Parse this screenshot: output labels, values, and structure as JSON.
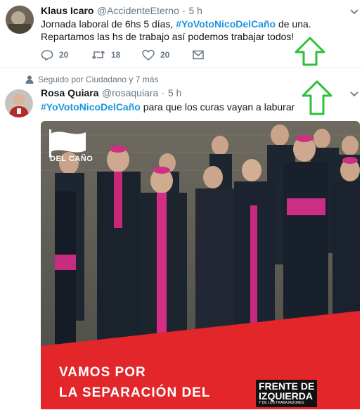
{
  "tweet1": {
    "name": "Klaus Icaro",
    "handle": "@AccidenteEterno",
    "sep": "·",
    "time": "5 h",
    "text_before": "Jornada laboral de 6hs 5 días, ",
    "hashtag": "#YoVotoNicoDelCaño",
    "text_after": " de una. Repartamos las hs de trabajo así podemos trabajar todos!",
    "replies": "20",
    "retweets": "18",
    "likes": "20"
  },
  "tweet2": {
    "social_context": "Seguido por Ciudadano y 7 más",
    "name": "Rosa Quiara",
    "handle": "@rosaquiara",
    "sep": "·",
    "time": "5 h",
    "hashtag": "#YoVotoNicoDelCaño",
    "text_after": " para que los curas vayan a laburar"
  },
  "media": {
    "logo_text": "DEL CAÑO",
    "banner_line1": "VAMOS POR",
    "banner_line2": "LA SEPARACIÓN DEL",
    "brand_line1": "FRENTE DE",
    "brand_line2": "IZQUIERDA",
    "brand_line3": "Y DE LOS TRABAJADORES"
  },
  "colors": {
    "hashtag": "#1b95e0",
    "muted": "#657786",
    "annotation_arrow": "#2fbf3a",
    "banner_red": "#e3262a"
  }
}
